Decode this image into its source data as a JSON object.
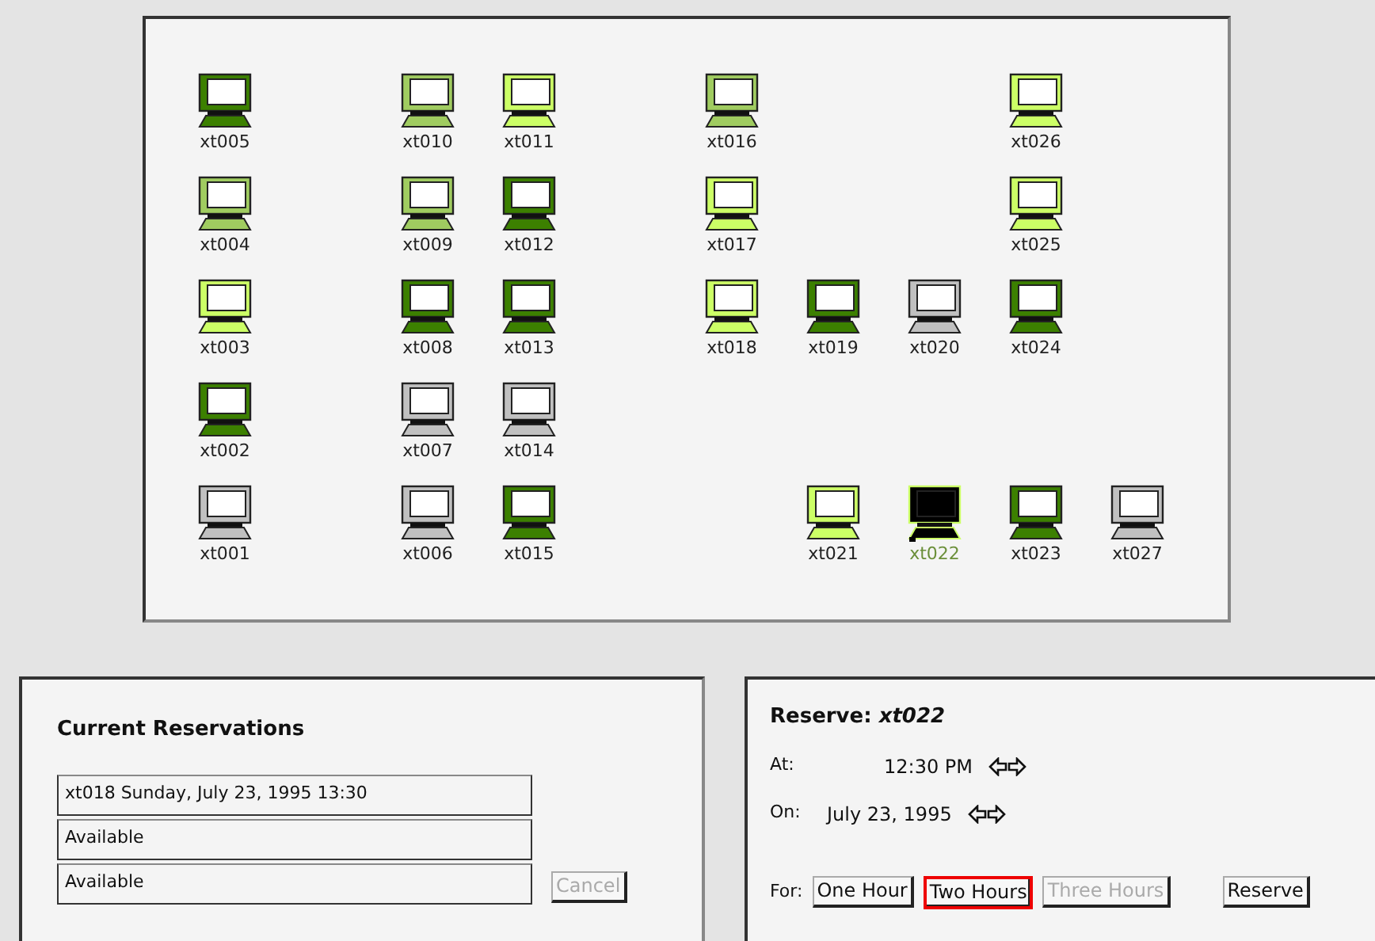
{
  "map": {
    "rows": [
      [
        {
          "label": "xt005",
          "color": "#3c8000",
          "selected": false
        },
        null,
        {
          "label": "xt010",
          "color": "#a0cc60",
          "selected": false
        },
        {
          "label": "xt011",
          "color": "#ccff66",
          "selected": false
        },
        null,
        {
          "label": "xt016",
          "color": "#a0cc60",
          "selected": false
        },
        null,
        null,
        {
          "label": "xt026",
          "color": "#ccff66",
          "selected": false
        },
        null
      ],
      [
        {
          "label": "xt004",
          "color": "#a0cc60",
          "selected": false
        },
        null,
        {
          "label": "xt009",
          "color": "#a0cc60",
          "selected": false
        },
        {
          "label": "xt012",
          "color": "#3c8000",
          "selected": false
        },
        null,
        {
          "label": "xt017",
          "color": "#ccff66",
          "selected": false
        },
        null,
        null,
        {
          "label": "xt025",
          "color": "#ccff66",
          "selected": false
        },
        null
      ],
      [
        {
          "label": "xt003",
          "color": "#ccff66",
          "selected": false
        },
        null,
        {
          "label": "xt008",
          "color": "#3c8000",
          "selected": false
        },
        {
          "label": "xt013",
          "color": "#3c8000",
          "selected": false
        },
        null,
        {
          "label": "xt018",
          "color": "#ccff66",
          "selected": false
        },
        {
          "label": "xt019",
          "color": "#3c8000",
          "selected": false
        },
        {
          "label": "xt020",
          "color": "#c0c0c0",
          "selected": false
        },
        {
          "label": "xt024",
          "color": "#3c8000",
          "selected": false
        },
        null
      ],
      [
        {
          "label": "xt002",
          "color": "#3c8000",
          "selected": false
        },
        null,
        {
          "label": "xt007",
          "color": "#c0c0c0",
          "selected": false
        },
        {
          "label": "xt014",
          "color": "#c0c0c0",
          "selected": false
        },
        null,
        null,
        null,
        null,
        null,
        null
      ],
      [
        {
          "label": "xt001",
          "color": "#c0c0c0",
          "selected": false
        },
        null,
        {
          "label": "xt006",
          "color": "#c0c0c0",
          "selected": false
        },
        {
          "label": "xt015",
          "color": "#3c8000",
          "selected": false
        },
        null,
        null,
        {
          "label": "xt021",
          "color": "#ccff66",
          "selected": false
        },
        {
          "label": "xt022",
          "color": "#ccff66",
          "selected": true
        },
        {
          "label": "xt023",
          "color": "#3c8000",
          "selected": false
        },
        {
          "label": "xt027",
          "color": "#c0c0c0",
          "selected": false
        }
      ]
    ]
  },
  "reservations": {
    "title": "Current Reservations",
    "slots": [
      "xt018 Sunday, July 23, 1995 13:30",
      "Available",
      "Available"
    ],
    "cancel": {
      "label": "Cancel",
      "disabled": true
    }
  },
  "reserve": {
    "title": "**Reserve:** *xt022*",
    "at": {
      "label": "At:",
      "value": "12:30 PM"
    },
    "on": {
      "label": "On:",
      "value": "July 23, 1995"
    },
    "for_label": "For:",
    "durations": [
      {
        "label": "One Hour",
        "selected": false,
        "disabled": false
      },
      {
        "label": "Two Hours",
        "selected": true,
        "disabled": false
      },
      {
        "label": "Three Hours",
        "selected": false,
        "disabled": true
      }
    ],
    "button": "Reserve"
  }
}
